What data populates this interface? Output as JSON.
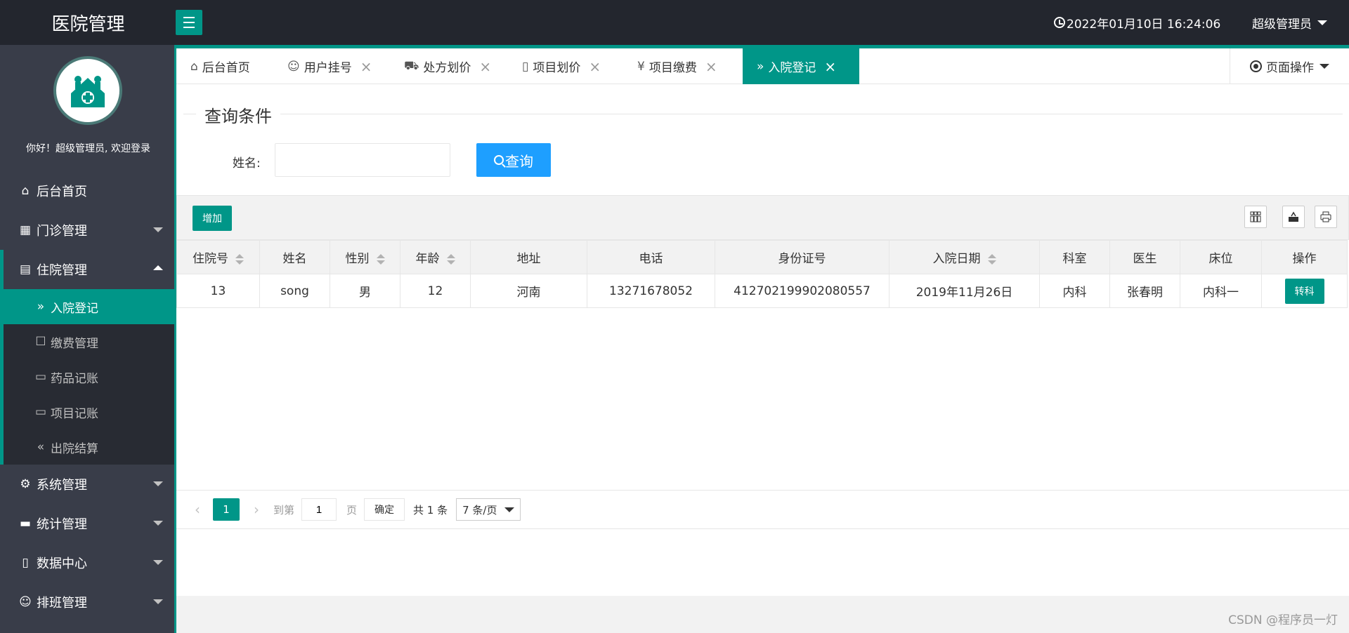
{
  "header": {
    "logo": "医院管理",
    "datetime": "2022年01月10日 16:24:06",
    "user": "超级管理员"
  },
  "sidebar": {
    "welcome": "你好！超级管理员, 欢迎登录",
    "items": [
      {
        "label": "后台首页",
        "icon": "home-icon"
      },
      {
        "label": "门诊管理",
        "icon": "grid-icon"
      },
      {
        "label": "住院管理",
        "icon": "building-icon"
      },
      {
        "label": "系统管理",
        "icon": "gear-icon"
      },
      {
        "label": "统计管理",
        "icon": "monitor-icon"
      },
      {
        "label": "数据中心",
        "icon": "document-icon"
      },
      {
        "label": "排班管理",
        "icon": "user-icon"
      }
    ],
    "sub_items": [
      {
        "label": "入院登记",
        "icon": "double-chevron-right-icon"
      },
      {
        "label": "缴费管理",
        "icon": "payment-icon"
      },
      {
        "label": "药品记账",
        "icon": "book-icon"
      },
      {
        "label": "项目记账",
        "icon": "book-icon"
      },
      {
        "label": "出院结算",
        "icon": "double-chevron-left-icon"
      }
    ]
  },
  "tabs": [
    {
      "label": "后台首页",
      "icon": "home-icon"
    },
    {
      "label": "用户挂号",
      "icon": "user-icon"
    },
    {
      "label": "处方划价",
      "icon": "cart-icon"
    },
    {
      "label": "项目划价",
      "icon": "file-icon"
    },
    {
      "label": "项目缴费",
      "icon": "yen-icon"
    },
    {
      "label": "入院登记",
      "icon": "double-chevron-right-icon"
    }
  ],
  "page_op": "页面操作",
  "search": {
    "legend": "查询条件",
    "name_label": "姓名:",
    "name_value": "",
    "button": "查询"
  },
  "toolbar": {
    "add": "增加"
  },
  "table": {
    "columns": [
      "住院号",
      "姓名",
      "性别",
      "年龄",
      "地址",
      "电话",
      "身份证号",
      "入院日期",
      "科室",
      "医生",
      "床位",
      "操作"
    ],
    "rows": [
      {
        "id": "13",
        "name": "song",
        "gender": "男",
        "age": "12",
        "address": "河南",
        "phone": "13271678052",
        "id_card": "412702199902080557",
        "date": "2019年11月26日",
        "dept": "内科",
        "doctor": "张春明",
        "bed": "内科一",
        "action": "转科"
      }
    ]
  },
  "pager": {
    "current": "1",
    "goto_label": "到第",
    "goto_value": "1",
    "page_label": "页",
    "confirm": "确定",
    "total": "共 1 条",
    "page_size": "7 条/页"
  },
  "watermark": "CSDN @程序员一灯",
  "colors": {
    "accent": "#009688",
    "blue": "#1e9fff",
    "header": "#23262e",
    "sidebar": "#393d49"
  }
}
